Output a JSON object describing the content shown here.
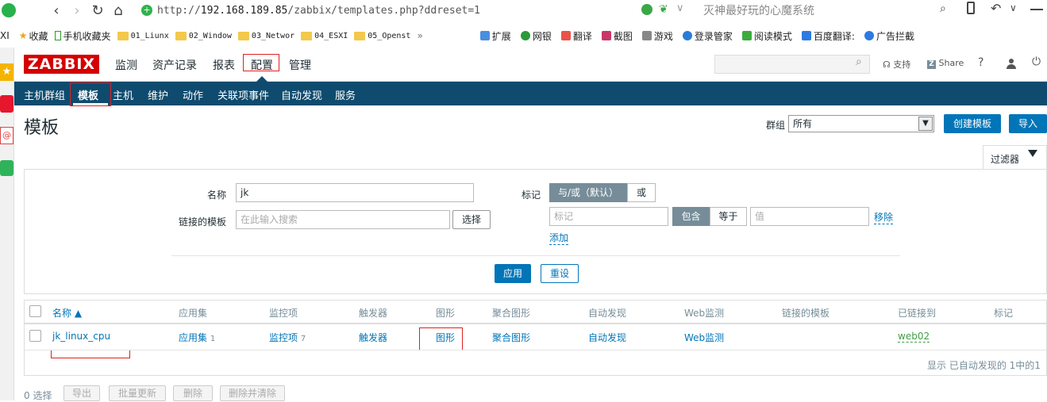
{
  "browser": {
    "url_prefix": "http://",
    "url_host": "192.168.189.85",
    "url_path": "/zabbix/templates.php?ddreset=1",
    "search_hint": "灭神最好玩的心魔系统",
    "left_cut": "XI",
    "bookmarks": [
      "收藏",
      "手机收藏夹",
      "01_Liunx",
      "02_Window",
      "03_Networ",
      "04_ESXI",
      "05_Openst"
    ],
    "more": "»",
    "tools": [
      "扩展",
      "网银",
      "翻译",
      "截图",
      "游戏",
      "登录管家",
      "阅读模式",
      "百度翻译:",
      "广告拦截"
    ]
  },
  "zabbix": {
    "logo": "ZABBIX",
    "main_menu": [
      "监测",
      "资产记录",
      "报表",
      "配置",
      "管理"
    ],
    "support": "支持",
    "share": "Share",
    "help": "?",
    "sub_menu": [
      "主机群组",
      "模板",
      "主机",
      "维护",
      "动作",
      "关联项事件",
      "自动发现",
      "服务"
    ]
  },
  "page": {
    "title": "模板",
    "group_label": "群组",
    "group_value": "所有",
    "create_button": "创建模板",
    "import_button": "导入",
    "filter_tab": "过滤器"
  },
  "filter": {
    "name_label": "名称",
    "name_value": "jk",
    "linked_label": "链接的模板",
    "linked_placeholder": "在此输入搜索",
    "select_button": "选择",
    "tag_label": "标记",
    "and_or": "与/或（默认）",
    "or": "或",
    "tag_placeholder": "标记",
    "contains": "包含",
    "equals": "等于",
    "value_placeholder": "值",
    "remove": "移除",
    "add": "添加",
    "apply": "应用",
    "reset": "重设"
  },
  "table": {
    "headers": [
      "名称 ▲",
      "应用集",
      "监控项",
      "触发器",
      "图形",
      "聚合图形",
      "自动发现",
      "Web监测",
      "链接的模板",
      "已链接到",
      "标记"
    ],
    "row": {
      "name": "jk_linux_cpu",
      "apps": "应用集",
      "apps_count": "1",
      "items": "监控项",
      "items_count": "7",
      "triggers": "触发器",
      "graphs": "图形",
      "screens": "聚合图形",
      "discovery": "自动发现",
      "web": "Web监测",
      "linked_to": "web02"
    },
    "footer": "显示 已自动发现的 1中的1"
  },
  "bottom": {
    "selected": "0 选择",
    "buttons": [
      "导出",
      "批量更新",
      "删除",
      "删除并清除"
    ]
  }
}
